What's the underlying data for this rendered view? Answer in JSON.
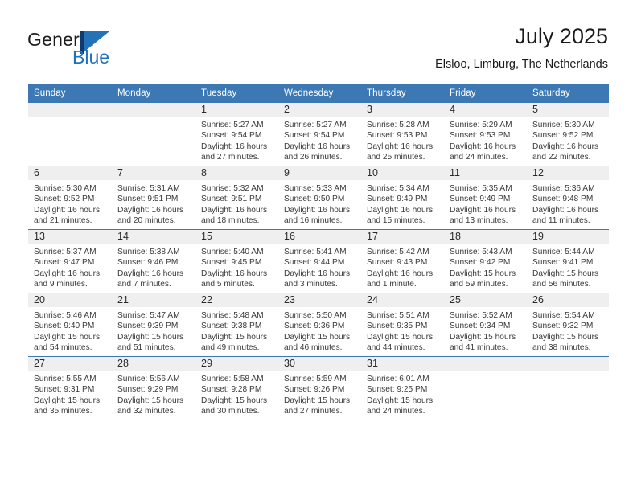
{
  "brand": {
    "name_part1": "General",
    "name_part2": "Blue",
    "logo_icon": "flag-triangle-icon"
  },
  "header": {
    "month_title": "July 2025",
    "location": "Elsloo, Limburg, The Netherlands"
  },
  "colors": {
    "header_blue": "#3b78b4",
    "brand_blue": "#1f72c0",
    "daynum_bg": "#efefef",
    "text": "#222222"
  },
  "weekday_headers": [
    "Sunday",
    "Monday",
    "Tuesday",
    "Wednesday",
    "Thursday",
    "Friday",
    "Saturday"
  ],
  "weeks": [
    [
      {
        "day": "",
        "lines": []
      },
      {
        "day": "",
        "lines": []
      },
      {
        "day": "1",
        "lines": [
          "Sunrise: 5:27 AM",
          "Sunset: 9:54 PM",
          "Daylight: 16 hours",
          "and 27 minutes."
        ]
      },
      {
        "day": "2",
        "lines": [
          "Sunrise: 5:27 AM",
          "Sunset: 9:54 PM",
          "Daylight: 16 hours",
          "and 26 minutes."
        ]
      },
      {
        "day": "3",
        "lines": [
          "Sunrise: 5:28 AM",
          "Sunset: 9:53 PM",
          "Daylight: 16 hours",
          "and 25 minutes."
        ]
      },
      {
        "day": "4",
        "lines": [
          "Sunrise: 5:29 AM",
          "Sunset: 9:53 PM",
          "Daylight: 16 hours",
          "and 24 minutes."
        ]
      },
      {
        "day": "5",
        "lines": [
          "Sunrise: 5:30 AM",
          "Sunset: 9:52 PM",
          "Daylight: 16 hours",
          "and 22 minutes."
        ]
      }
    ],
    [
      {
        "day": "6",
        "lines": [
          "Sunrise: 5:30 AM",
          "Sunset: 9:52 PM",
          "Daylight: 16 hours",
          "and 21 minutes."
        ]
      },
      {
        "day": "7",
        "lines": [
          "Sunrise: 5:31 AM",
          "Sunset: 9:51 PM",
          "Daylight: 16 hours",
          "and 20 minutes."
        ]
      },
      {
        "day": "8",
        "lines": [
          "Sunrise: 5:32 AM",
          "Sunset: 9:51 PM",
          "Daylight: 16 hours",
          "and 18 minutes."
        ]
      },
      {
        "day": "9",
        "lines": [
          "Sunrise: 5:33 AM",
          "Sunset: 9:50 PM",
          "Daylight: 16 hours",
          "and 16 minutes."
        ]
      },
      {
        "day": "10",
        "lines": [
          "Sunrise: 5:34 AM",
          "Sunset: 9:49 PM",
          "Daylight: 16 hours",
          "and 15 minutes."
        ]
      },
      {
        "day": "11",
        "lines": [
          "Sunrise: 5:35 AM",
          "Sunset: 9:49 PM",
          "Daylight: 16 hours",
          "and 13 minutes."
        ]
      },
      {
        "day": "12",
        "lines": [
          "Sunrise: 5:36 AM",
          "Sunset: 9:48 PM",
          "Daylight: 16 hours",
          "and 11 minutes."
        ]
      }
    ],
    [
      {
        "day": "13",
        "lines": [
          "Sunrise: 5:37 AM",
          "Sunset: 9:47 PM",
          "Daylight: 16 hours",
          "and 9 minutes."
        ]
      },
      {
        "day": "14",
        "lines": [
          "Sunrise: 5:38 AM",
          "Sunset: 9:46 PM",
          "Daylight: 16 hours",
          "and 7 minutes."
        ]
      },
      {
        "day": "15",
        "lines": [
          "Sunrise: 5:40 AM",
          "Sunset: 9:45 PM",
          "Daylight: 16 hours",
          "and 5 minutes."
        ]
      },
      {
        "day": "16",
        "lines": [
          "Sunrise: 5:41 AM",
          "Sunset: 9:44 PM",
          "Daylight: 16 hours",
          "and 3 minutes."
        ]
      },
      {
        "day": "17",
        "lines": [
          "Sunrise: 5:42 AM",
          "Sunset: 9:43 PM",
          "Daylight: 16 hours",
          "and 1 minute."
        ]
      },
      {
        "day": "18",
        "lines": [
          "Sunrise: 5:43 AM",
          "Sunset: 9:42 PM",
          "Daylight: 15 hours",
          "and 59 minutes."
        ]
      },
      {
        "day": "19",
        "lines": [
          "Sunrise: 5:44 AM",
          "Sunset: 9:41 PM",
          "Daylight: 15 hours",
          "and 56 minutes."
        ]
      }
    ],
    [
      {
        "day": "20",
        "lines": [
          "Sunrise: 5:46 AM",
          "Sunset: 9:40 PM",
          "Daylight: 15 hours",
          "and 54 minutes."
        ]
      },
      {
        "day": "21",
        "lines": [
          "Sunrise: 5:47 AM",
          "Sunset: 9:39 PM",
          "Daylight: 15 hours",
          "and 51 minutes."
        ]
      },
      {
        "day": "22",
        "lines": [
          "Sunrise: 5:48 AM",
          "Sunset: 9:38 PM",
          "Daylight: 15 hours",
          "and 49 minutes."
        ]
      },
      {
        "day": "23",
        "lines": [
          "Sunrise: 5:50 AM",
          "Sunset: 9:36 PM",
          "Daylight: 15 hours",
          "and 46 minutes."
        ]
      },
      {
        "day": "24",
        "lines": [
          "Sunrise: 5:51 AM",
          "Sunset: 9:35 PM",
          "Daylight: 15 hours",
          "and 44 minutes."
        ]
      },
      {
        "day": "25",
        "lines": [
          "Sunrise: 5:52 AM",
          "Sunset: 9:34 PM",
          "Daylight: 15 hours",
          "and 41 minutes."
        ]
      },
      {
        "day": "26",
        "lines": [
          "Sunrise: 5:54 AM",
          "Sunset: 9:32 PM",
          "Daylight: 15 hours",
          "and 38 minutes."
        ]
      }
    ],
    [
      {
        "day": "27",
        "lines": [
          "Sunrise: 5:55 AM",
          "Sunset: 9:31 PM",
          "Daylight: 15 hours",
          "and 35 minutes."
        ]
      },
      {
        "day": "28",
        "lines": [
          "Sunrise: 5:56 AM",
          "Sunset: 9:29 PM",
          "Daylight: 15 hours",
          "and 32 minutes."
        ]
      },
      {
        "day": "29",
        "lines": [
          "Sunrise: 5:58 AM",
          "Sunset: 9:28 PM",
          "Daylight: 15 hours",
          "and 30 minutes."
        ]
      },
      {
        "day": "30",
        "lines": [
          "Sunrise: 5:59 AM",
          "Sunset: 9:26 PM",
          "Daylight: 15 hours",
          "and 27 minutes."
        ]
      },
      {
        "day": "31",
        "lines": [
          "Sunrise: 6:01 AM",
          "Sunset: 9:25 PM",
          "Daylight: 15 hours",
          "and 24 minutes."
        ]
      },
      {
        "day": "",
        "lines": []
      },
      {
        "day": "",
        "lines": []
      }
    ]
  ]
}
